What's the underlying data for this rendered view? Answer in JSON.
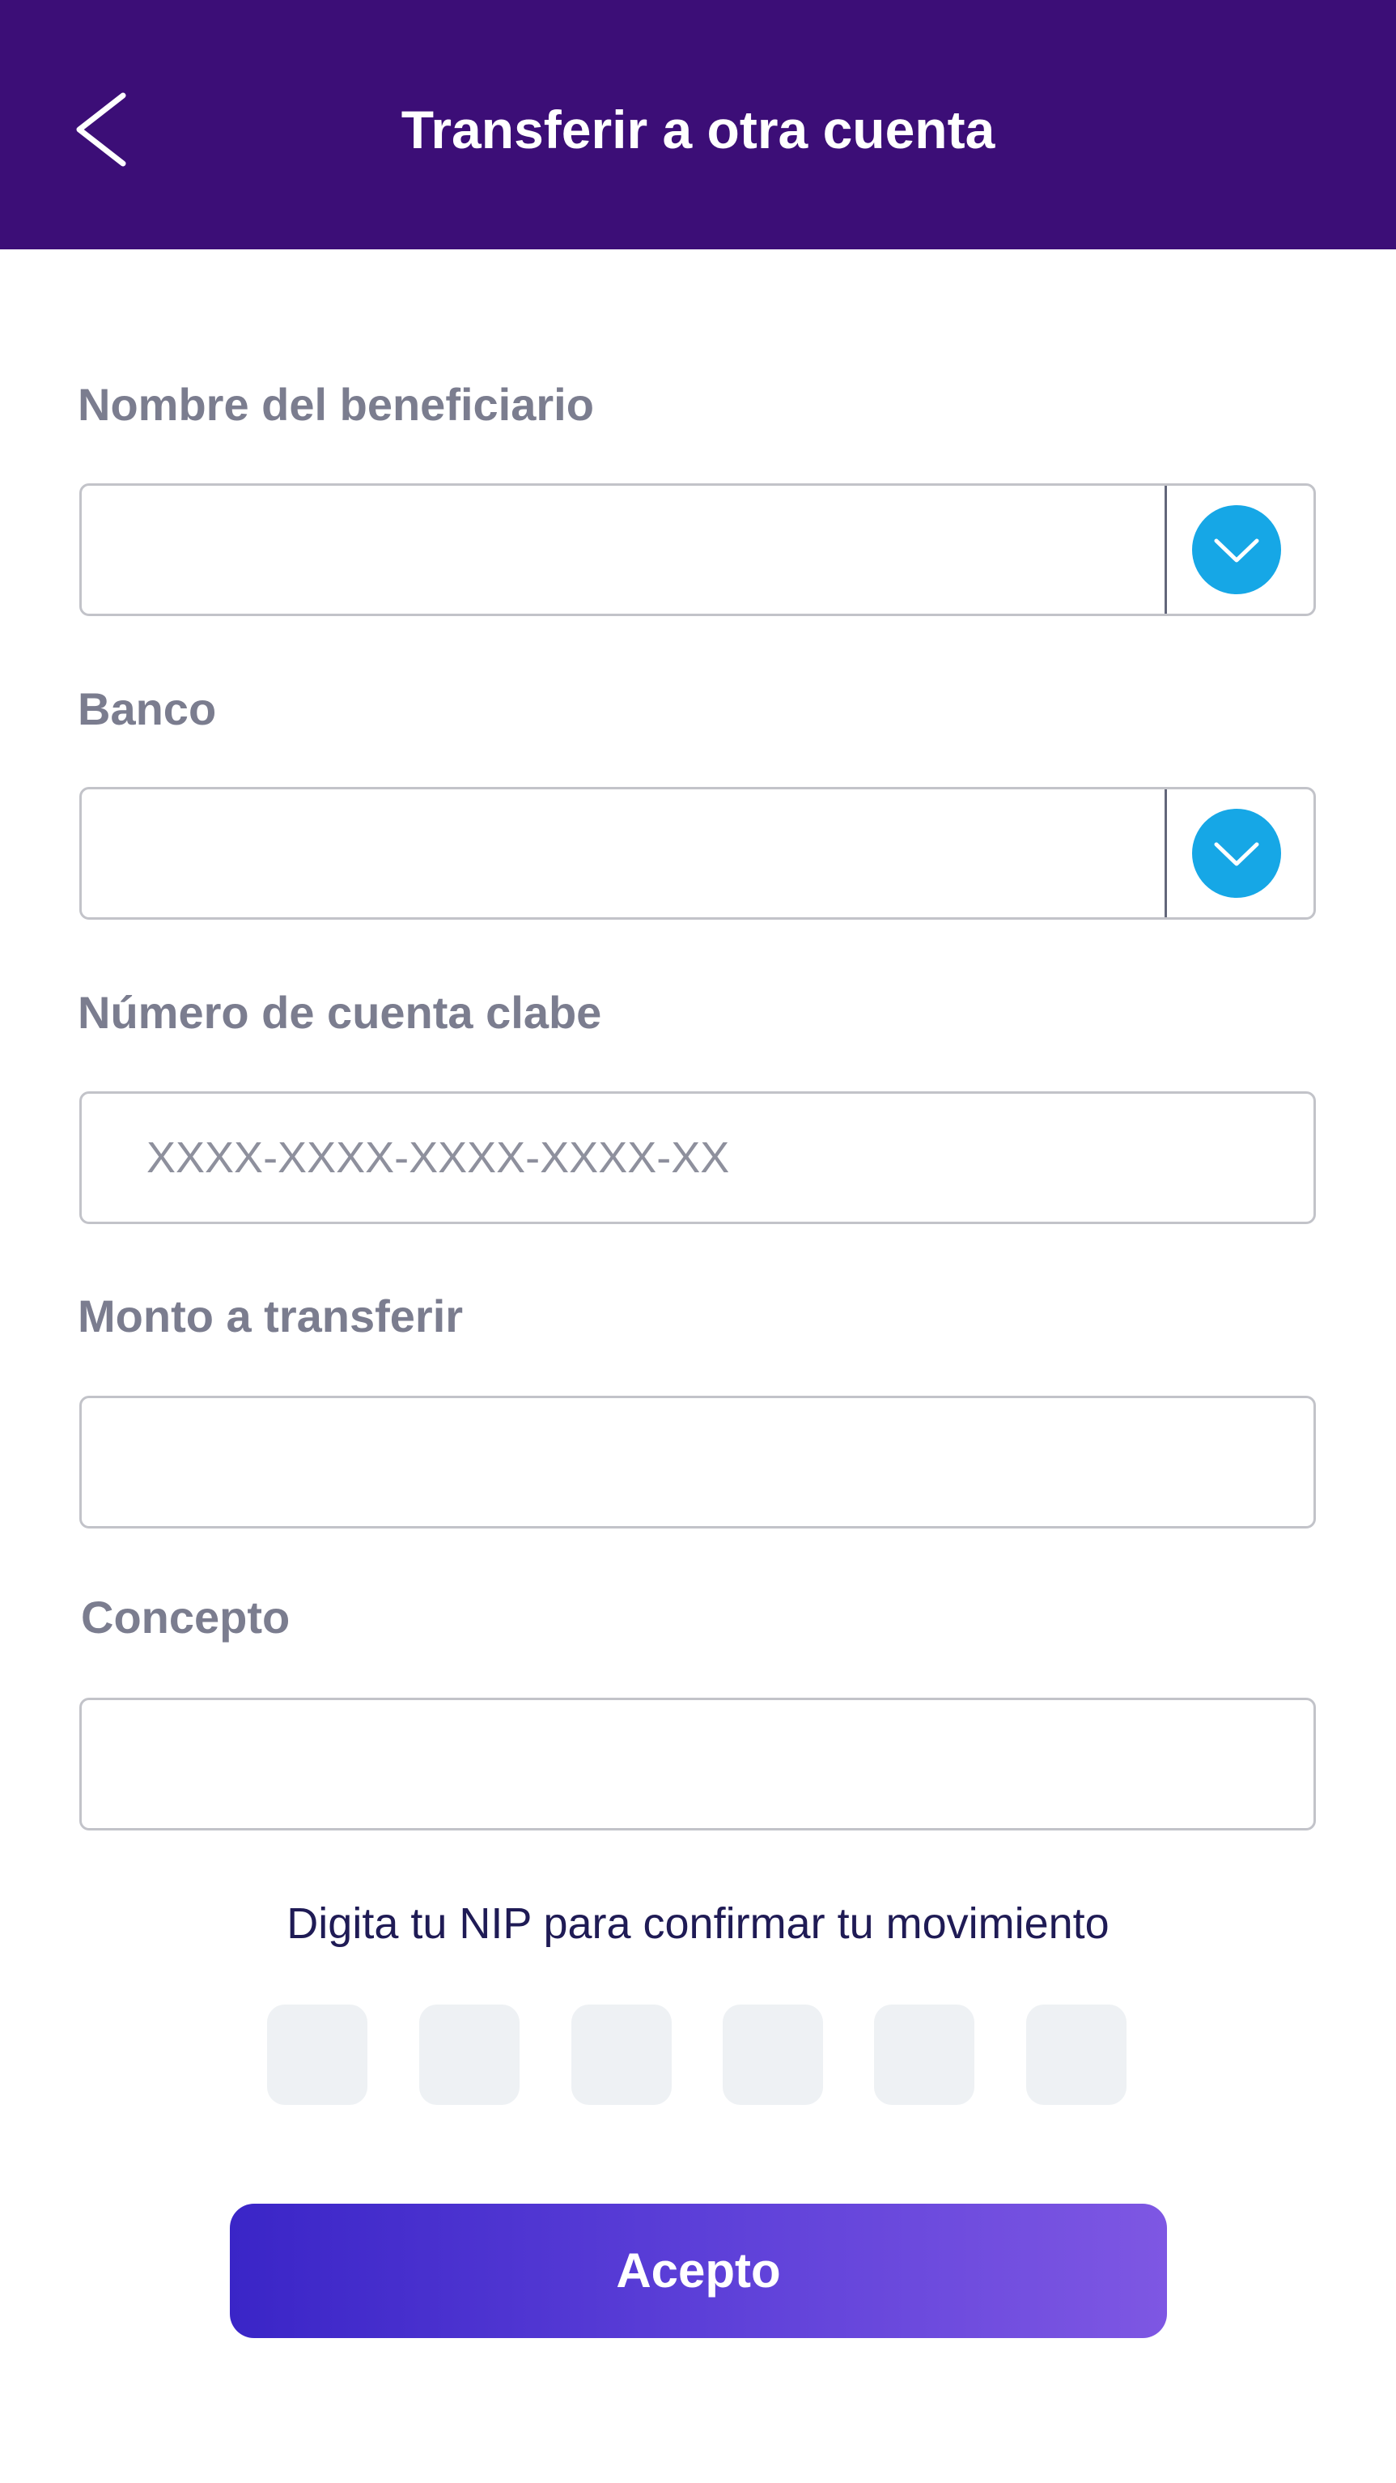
{
  "header": {
    "title": "Transferir a otra cuenta",
    "back_icon": "chevron-left-icon",
    "background": "#3c0e77"
  },
  "form": {
    "beneficiary": {
      "label": "Nombre del beneficiario",
      "value": "",
      "dropdown_icon": "chevron-down-icon"
    },
    "bank": {
      "label": "Banco",
      "value": "",
      "dropdown_icon": "chevron-down-icon"
    },
    "clabe": {
      "label": "Número de cuenta clabe",
      "placeholder": "XXXX-XXXX-XXXX-XXXX-XX",
      "value": ""
    },
    "amount": {
      "label": "Monto a transferir",
      "value": ""
    },
    "concept": {
      "label": "Concepto",
      "value": ""
    }
  },
  "nip": {
    "prompt": "Digita tu NIP para confirmar tu movimiento",
    "digits": [
      "",
      "",
      "",
      "",
      "",
      ""
    ]
  },
  "actions": {
    "accept_label": "Acepto"
  },
  "colors": {
    "accent": "#16a7e6",
    "label": "#7b7d8f",
    "button_gradient_start": "#3a25c7",
    "button_gradient_end": "#7e57e3"
  }
}
